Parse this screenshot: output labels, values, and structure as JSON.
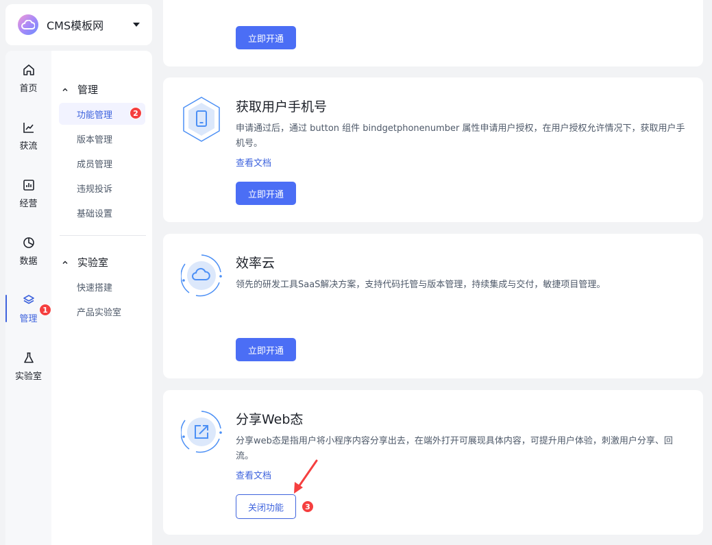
{
  "brand": {
    "name": "CMS模板网"
  },
  "iconbar": {
    "items": [
      {
        "label": "首页",
        "icon": "home-icon"
      },
      {
        "label": "获流",
        "icon": "trend-icon"
      },
      {
        "label": "经营",
        "icon": "chart-box-icon"
      },
      {
        "label": "数据",
        "icon": "pie-icon"
      },
      {
        "label": "管理",
        "icon": "layers-icon",
        "badge": "1"
      },
      {
        "label": "实验室",
        "icon": "flask-icon"
      }
    ],
    "active": "管理"
  },
  "submenu": {
    "group1": {
      "title": "管理",
      "items": [
        "功能管理",
        "版本管理",
        "成员管理",
        "违规投诉",
        "基础设置"
      ],
      "active_badge": "2"
    },
    "group2": {
      "title": "实验室",
      "items": [
        "快速搭建",
        "产品实验室"
      ]
    }
  },
  "cards": {
    "top": {
      "button": "立即开通"
    },
    "phone": {
      "title": "获取用户手机号",
      "desc": "申请通过后，通过 button 组件 bindgetphonenumber 属性申请用户授权，在用户授权允许情况下，获取用户手机号。",
      "link": "查看文档",
      "button": "立即开通"
    },
    "cloud": {
      "title": "效率云",
      "desc": "领先的研发工具SaaS解决方案，支持代码托管与版本管理，持续集成与交付，敏捷项目管理。",
      "button": "立即开通"
    },
    "share": {
      "title": "分享Web态",
      "desc": "分享web态是指用户将小程序内容分享出去，在端外打开可展现具体内容，可提升用户体验，刺激用户分享、回流。",
      "link": "查看文档",
      "button": "关闭功能",
      "badge": "3"
    }
  },
  "colors": {
    "accent": "#4b6ef5",
    "badge": "#f53f3f",
    "active_text": "#3e63dd"
  }
}
